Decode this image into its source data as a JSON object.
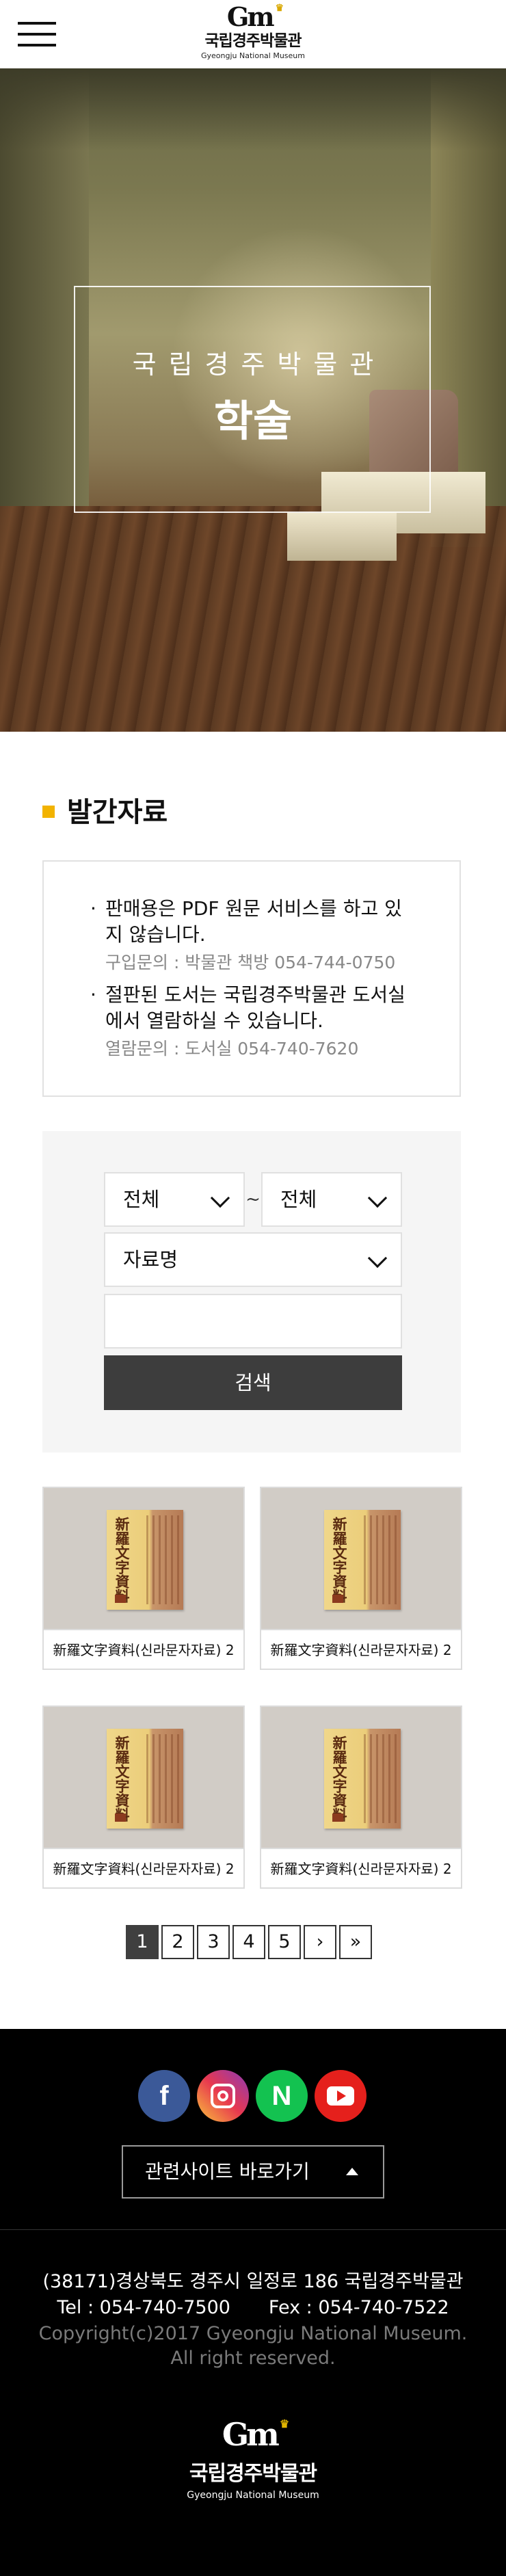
{
  "header": {
    "logo_mark": "Gm",
    "logo_name_ko": "국립경주박물관",
    "logo_name_en": "Gyeongju National Museum"
  },
  "hero": {
    "subtitle": "국립경주박물관",
    "title": "학술"
  },
  "section": {
    "title": "발간자료"
  },
  "notice": {
    "items": [
      {
        "text": "판매용은 PDF 원문 서비스를 하고 있지 않습니다.",
        "sub": "구입문의 : 박물관 책방 054-744-0750"
      },
      {
        "text": "절판된 도서는 국립경주박물관 도서실에서 열람하실 수 있습니다.",
        "sub": "열람문의 : 도서실 054-740-7620"
      }
    ]
  },
  "search": {
    "from_value": "전체",
    "tilde": "~",
    "to_value": "전체",
    "field_value": "자료명",
    "input_value": "",
    "button_label": "검색"
  },
  "publications": [
    {
      "cover_title": "新羅文字資料",
      "caption": "新羅文字資料(신라문자자료) 2"
    },
    {
      "cover_title": "新羅文字資料",
      "caption": "新羅文字資料(신라문자자료) 2"
    },
    {
      "cover_title": "新羅文字資料",
      "caption": "新羅文字資料(신라문자자료) 2"
    },
    {
      "cover_title": "新羅文字資料",
      "caption": "新羅文字資料(신라문자자료) 2"
    }
  ],
  "pagination": {
    "pages": [
      "1",
      "2",
      "3",
      "4",
      "5"
    ],
    "current": "1",
    "next": "›",
    "last": "»"
  },
  "footer": {
    "social": [
      {
        "icon": "facebook-icon",
        "glyph": "f",
        "color": "#3b5998"
      },
      {
        "icon": "instagram-icon",
        "glyph": "",
        "color": "#e8384f"
      },
      {
        "icon": "naver-icon",
        "glyph": "N",
        "color": "#13c250"
      },
      {
        "icon": "youtube-icon",
        "glyph": "",
        "color": "#e5201c"
      }
    ],
    "related_sites_label": "관련사이트 바로가기",
    "address": "(38171)경상북도 경주시 일정로 186 국립경주박물관",
    "tel": "Tel : 054-740-7500",
    "fax": "Fex : 054-740-7522",
    "copyright": "Copyright(c)2017 Gyeongju National Museum. All right reserved.",
    "logo_mark": "Gm",
    "logo_name_ko": "국립경주박물관",
    "logo_name_en": "Gyeongju National Museum"
  },
  "colors": {
    "accent": "#f2b300",
    "button_dark": "#3d3d3d",
    "footer_bg": "#000000"
  }
}
